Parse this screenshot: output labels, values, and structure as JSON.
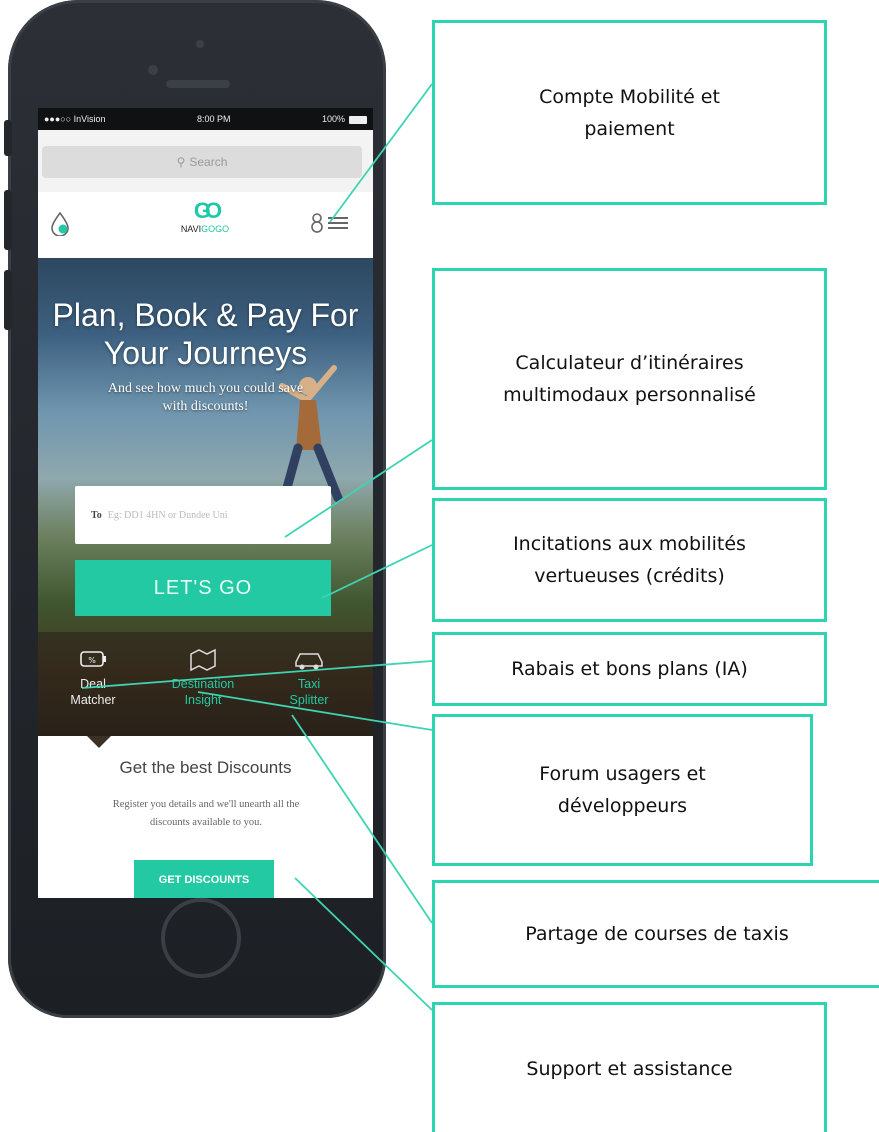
{
  "status_bar": {
    "carrier": "●●●○○ InVision",
    "time": "8:00 PM",
    "battery": "100%"
  },
  "search": {
    "placeholder": "Search"
  },
  "brand": {
    "logo_mark": "GO",
    "name_prefix": "NAVI",
    "name_suffix": "GOGO"
  },
  "hero": {
    "title_line1": "Plan, Book & Pay For",
    "title_line2": "Your Journeys",
    "subtitle_line1": "And see how much you could save",
    "subtitle_line2": "with discounts!",
    "to_label": "To",
    "to_placeholder": "Eg: DD1 4HN or Dundee Uni",
    "cta": "LET'S GO"
  },
  "features": [
    {
      "line1": "Deal",
      "line2": "Matcher",
      "icon": "percent-battery-icon"
    },
    {
      "line1": "Destination",
      "line2": "Insight",
      "icon": "map-icon"
    },
    {
      "line1": "Taxi",
      "line2": "Splitter",
      "icon": "car-icon"
    }
  ],
  "promo": {
    "title": "Get the best Discounts",
    "text_line1": "Register you details and we'll unearth all the",
    "text_line2": "discounts available to you.",
    "button": "GET DISCOUNTS"
  },
  "callouts": [
    {
      "line1": "Compte Mobilité et",
      "line2": "paiement"
    },
    {
      "line1": "Calculateur d’itinéraires",
      "line2": "multimodaux personnalisé"
    },
    {
      "line1": "Incitations aux mobilités",
      "line2": "vertueuses (crédits)"
    },
    {
      "line1": "Rabais et bons plans (IA)"
    },
    {
      "line1": "Forum usagers et",
      "line2": "développeurs"
    },
    {
      "line1": "Partage de courses de taxis"
    },
    {
      "line1": "Support et assistance"
    }
  ],
  "colors": {
    "accent": "#22c9a2",
    "callout_border": "#2dd4b0",
    "phone_body": "#23262b"
  }
}
